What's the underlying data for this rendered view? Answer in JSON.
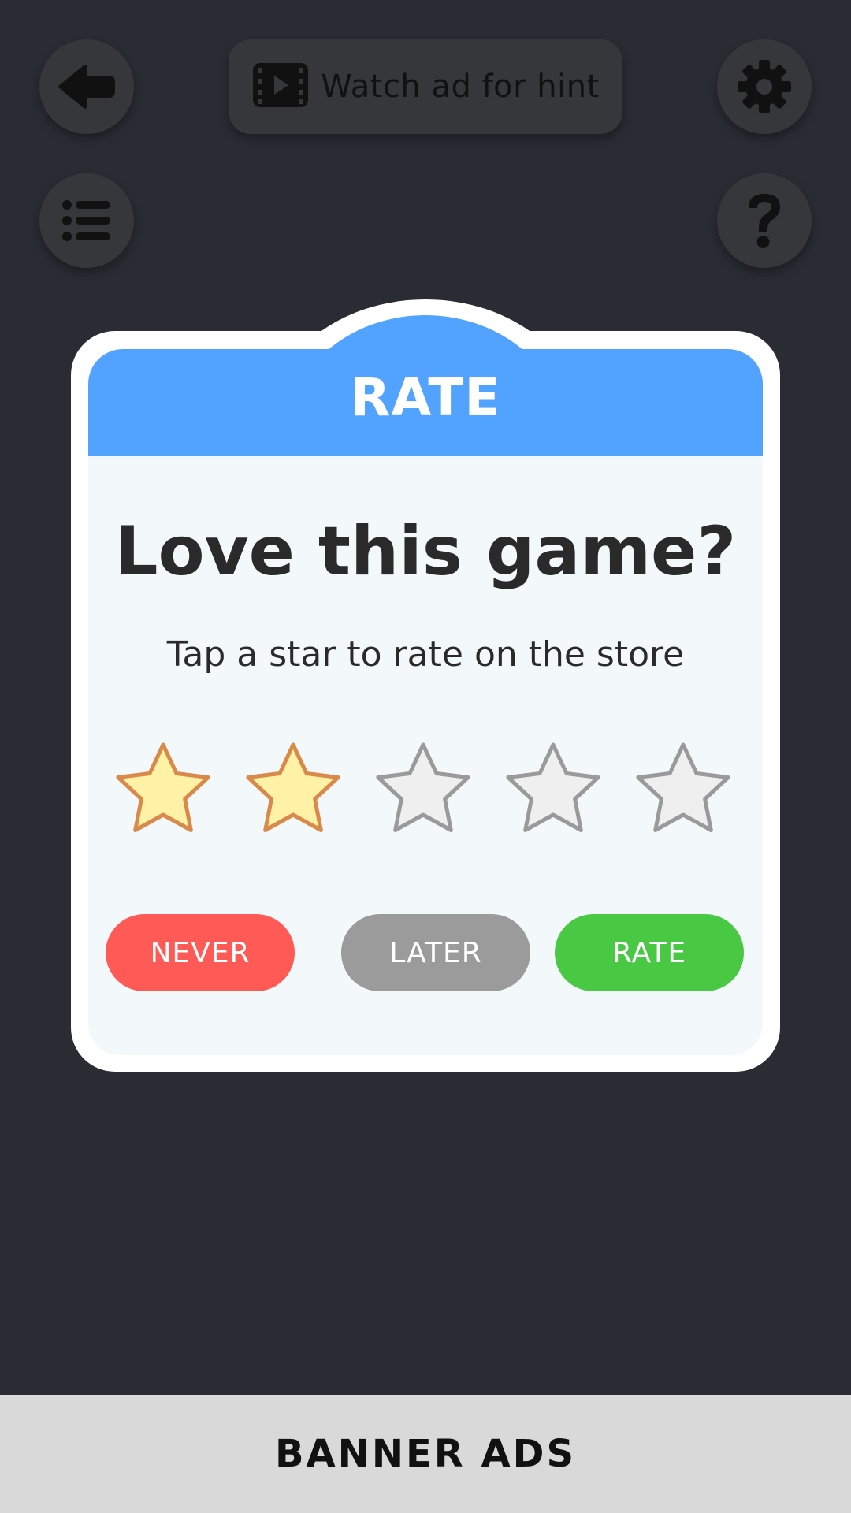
{
  "toolbar": {
    "hint_label": "Watch ad for hint",
    "icons": [
      "back-arrow-icon",
      "video-icon",
      "gear-icon",
      "list-icon",
      "question-icon"
    ]
  },
  "dialog": {
    "title": "RATE",
    "headline": "Love this game?",
    "subline": "Tap a star to rate on the store",
    "rating": {
      "value": 2,
      "max": 5
    },
    "buttons": {
      "never": "NEVER",
      "later": "LATER",
      "rate": "RATE"
    }
  },
  "colors": {
    "background": "#292c33",
    "header": "#52a3ff",
    "never": "#ff5a55",
    "later": "#9b9b9b",
    "rate": "#49c843",
    "star_filled": "#fff1a6",
    "star_empty": "#efefef"
  },
  "banner": {
    "label": "BANNER ADS"
  }
}
